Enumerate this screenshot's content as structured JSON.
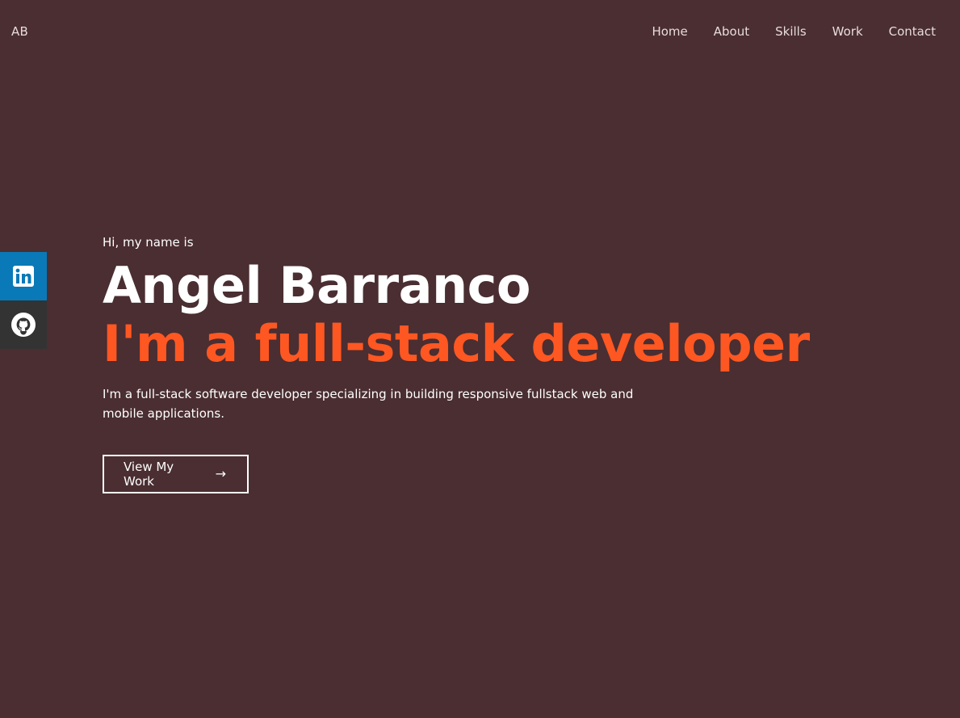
{
  "header": {
    "logo": "AB",
    "nav": [
      "Home",
      "About",
      "Skills",
      "Work",
      "Contact"
    ]
  },
  "social": {
    "linkedin_icon": "linkedin-icon",
    "github_icon": "github-icon",
    "linkedin_color": "#0a79b8",
    "github_color": "#333333"
  },
  "hero": {
    "greeting": "Hi, my name is",
    "name": "Angel Barranco",
    "role": "I'm a full-stack developer",
    "description": "I'm a full-stack software developer specializing in building responsive fullstack web and mobile applications.",
    "cta_label": "View My Work",
    "cta_icon": "arrow-right-icon"
  },
  "colors": {
    "background": "#4a2e31",
    "accent": "#ff5722",
    "text": "#ffffff"
  }
}
